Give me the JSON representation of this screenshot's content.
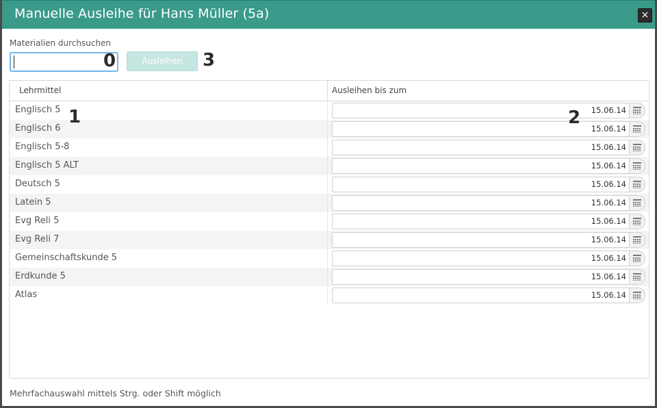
{
  "dialog": {
    "title": "Manuelle Ausleihe für Hans Müller (5a)",
    "close_label": "×"
  },
  "search": {
    "label": "Materialien durchsuchen",
    "value": "",
    "button_label": "Ausleihen"
  },
  "callouts": [
    "0",
    "1",
    "2",
    "3"
  ],
  "grid": {
    "columns": [
      "Lehrmittel",
      "Ausleihen bis zum"
    ],
    "rows": [
      {
        "name": "Englisch 5",
        "date": "15.06.14"
      },
      {
        "name": "Englisch 6",
        "date": "15.06.14"
      },
      {
        "name": "Englisch 5-8",
        "date": "15.06.14"
      },
      {
        "name": "Englisch 5 ALT",
        "date": "15.06.14"
      },
      {
        "name": "Deutsch 5",
        "date": "15.06.14"
      },
      {
        "name": "Latein 5",
        "date": "15.06.14"
      },
      {
        "name": "Evg Reli 5",
        "date": "15.06.14"
      },
      {
        "name": "Evg Reli 7",
        "date": "15.06.14"
      },
      {
        "name": "Gemeinschaftskunde 5",
        "date": "15.06.14"
      },
      {
        "name": "Erdkunde 5",
        "date": "15.06.14"
      },
      {
        "name": "Atlas",
        "date": "15.06.14"
      }
    ]
  },
  "footer": {
    "hint": "Mehrfachauswahl mittels Strg. oder Shift möglich"
  },
  "colors": {
    "titlebar": "#3a9b8a",
    "button_disabled": "#c6e6e2",
    "focus_border": "#6fb8e8"
  },
  "icons": [
    "close-icon",
    "calendar-icon"
  ]
}
